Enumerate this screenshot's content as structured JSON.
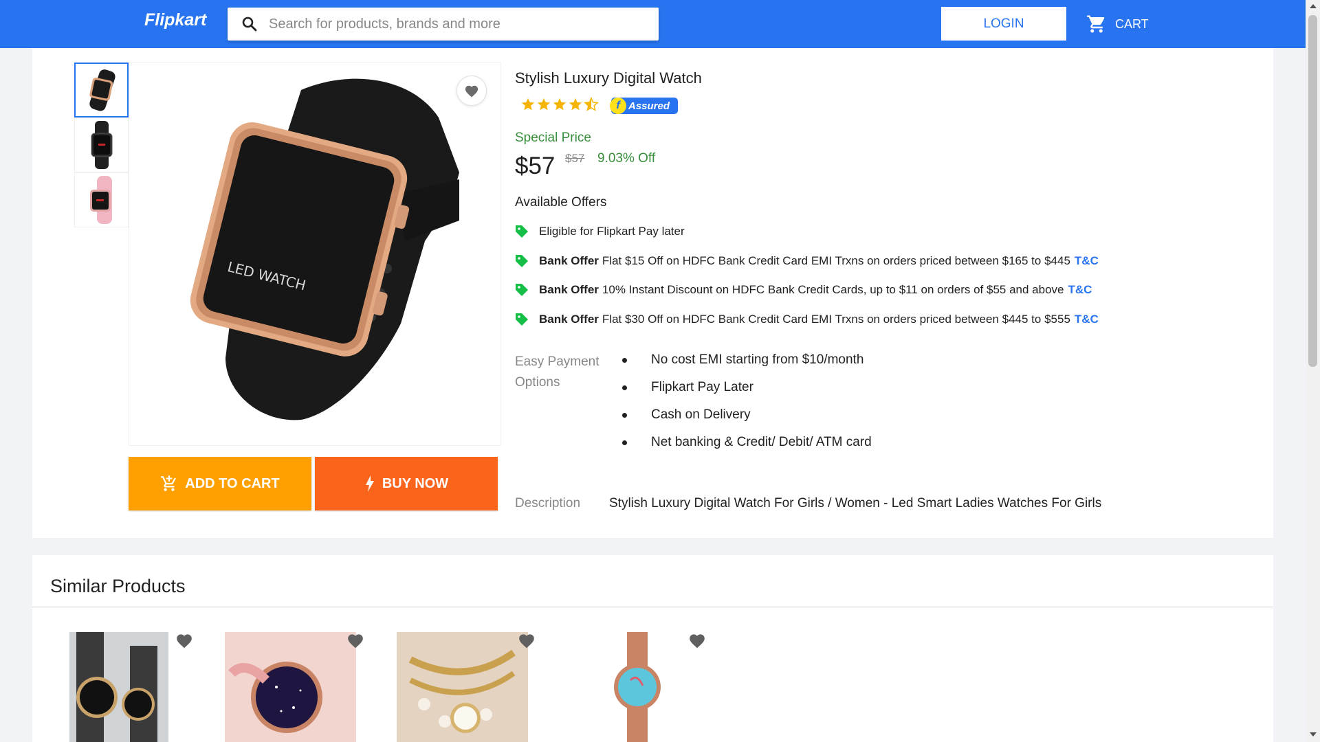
{
  "header": {
    "logo": "Flipkart",
    "search_placeholder": "Search for products, brands and more",
    "login_label": "LOGIN",
    "cart_label": "CART"
  },
  "product": {
    "title": "Stylish Luxury Digital Watch",
    "rating": 4.5,
    "assured_label": "Assured",
    "special_price_label": "Special Price",
    "price": "$57",
    "mrp": "$57",
    "discount": "9.03% Off",
    "thumbnails": [
      "black-watch-angle",
      "black-watch-front",
      "pink-watch"
    ],
    "image_text": "LED WATCH"
  },
  "actions": {
    "add_to_cart": "ADD TO CART",
    "buy_now": "BUY NOW"
  },
  "offers": {
    "heading": "Available Offers",
    "items": [
      {
        "bold": "",
        "text": "Eligible for Flipkart Pay later",
        "tnc": ""
      },
      {
        "bold": "Bank Offer",
        "text": "Flat $15 Off on HDFC Bank Credit Card EMI Trxns on orders priced between $165 to $445",
        "tnc": "T&C"
      },
      {
        "bold": "Bank Offer",
        "text": "10% Instant Discount on HDFC Bank Credit Cards, up to $11 on orders of $55 and above",
        "tnc": "T&C"
      },
      {
        "bold": "Bank Offer",
        "text": "Flat $30 Off on HDFC Bank Credit Card EMI Trxns on orders priced between $445 to $555",
        "tnc": "T&C"
      }
    ]
  },
  "payment": {
    "label": "Easy Payment Options",
    "options": [
      "No cost EMI starting from $10/month",
      "Flipkart Pay Later",
      "Cash on Delivery",
      "Net banking & Credit/ Debit/ ATM card"
    ]
  },
  "description": {
    "label": "Description",
    "text": "Stylish Luxury Digital Watch For Girls / Women - Led Smart Ladies Watches For Girls"
  },
  "similar": {
    "title": "Similar Products",
    "items": [
      "couple-watch-set",
      "starry-magnet-watch",
      "pearl-bracelet-watch",
      "blue-dial-rose-gold-watch"
    ]
  },
  "colors": {
    "brand": "#2874f0",
    "add_to_cart": "#ff9f00",
    "buy_now": "#fb641b",
    "green": "#388e3c"
  }
}
